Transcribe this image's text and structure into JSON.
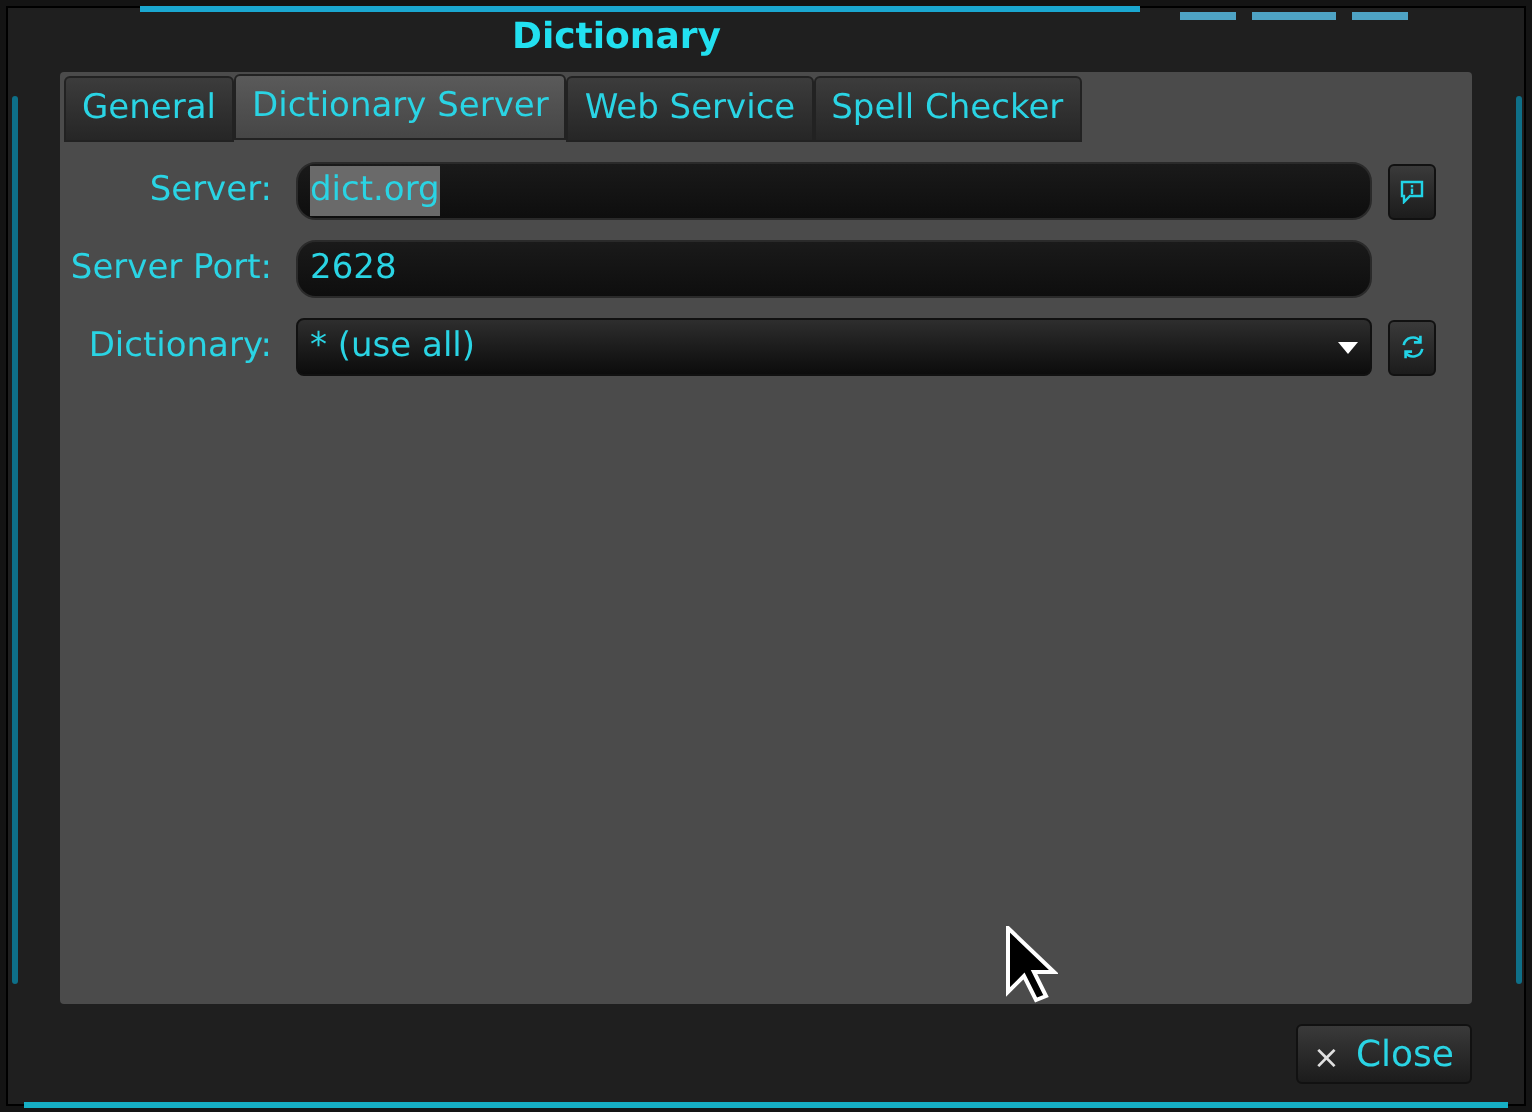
{
  "window": {
    "title": "Dictionary"
  },
  "tabs": [
    {
      "label": "General",
      "selected": false
    },
    {
      "label": "Dictionary Server",
      "selected": true
    },
    {
      "label": "Web Service",
      "selected": false
    },
    {
      "label": "Spell Checker",
      "selected": false
    }
  ],
  "fields": [
    {
      "label": "Server:",
      "kind": "text",
      "value": "dict.org",
      "highlighted": true,
      "button": {
        "kind": "info"
      }
    },
    {
      "label": "Server Port:",
      "kind": "text",
      "value": "2628",
      "highlighted": false
    },
    {
      "label": "Dictionary:",
      "kind": "dropdown",
      "value": "* (use all)",
      "highlighted": false,
      "button": {
        "kind": "refresh"
      }
    }
  ],
  "buttons": [
    {
      "label": "Close",
      "icon": "×"
    }
  ]
}
